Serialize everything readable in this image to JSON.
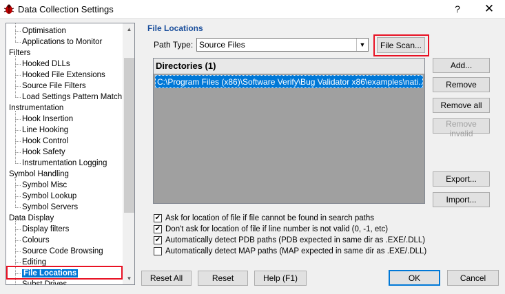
{
  "window": {
    "title": "Data Collection Settings",
    "help": "?",
    "close": "✕"
  },
  "tree": {
    "rows": [
      {
        "label": "Optimisation",
        "level": 1
      },
      {
        "label": "Applications to Monitor",
        "level": 1
      },
      {
        "label": "Filters",
        "level": 0
      },
      {
        "label": "Hooked DLLs",
        "level": 1
      },
      {
        "label": "Hooked File Extensions",
        "level": 1
      },
      {
        "label": "Source File Filters",
        "level": 1
      },
      {
        "label": "Load Settings Pattern Match",
        "level": 1
      },
      {
        "label": "Instrumentation",
        "level": 0
      },
      {
        "label": "Hook Insertion",
        "level": 1
      },
      {
        "label": "Line Hooking",
        "level": 1
      },
      {
        "label": "Hook Control",
        "level": 1
      },
      {
        "label": "Hook Safety",
        "level": 1
      },
      {
        "label": "Instrumentation Logging",
        "level": 1
      },
      {
        "label": "Symbol Handling",
        "level": 0
      },
      {
        "label": "Symbol Misc",
        "level": 1
      },
      {
        "label": "Symbol Lookup",
        "level": 1
      },
      {
        "label": "Symbol Servers",
        "level": 1
      },
      {
        "label": "Data Display",
        "level": 0
      },
      {
        "label": "Display filters",
        "level": 1
      },
      {
        "label": "Colours",
        "level": 1
      },
      {
        "label": "Source Code Browsing",
        "level": 1
      },
      {
        "label": "Editing",
        "level": 1
      },
      {
        "label": "File Locations",
        "level": 1,
        "selected": true
      },
      {
        "label": "Subst Drives",
        "level": 1
      }
    ]
  },
  "content": {
    "section_title": "File Locations",
    "path_type_label": "Path Type:",
    "path_type_value": "Source Files",
    "file_scan": "File Scan...",
    "directories_header": "Directories (1)",
    "directory_path": "C:\\Program Files (x86)\\Software Verify\\Bug Validator x86\\examples\\nati...",
    "buttons": {
      "add": "Add...",
      "remove": "Remove",
      "remove_all": "Remove all",
      "remove_invalid": "Remove invalid",
      "export": "Export...",
      "import": "Import..."
    },
    "checkboxes": [
      {
        "label": "Ask for location of file if file cannot be found in search paths",
        "checked": true
      },
      {
        "label": "Don't ask for location of file if line number is not valid (0, -1, etc)",
        "checked": true
      },
      {
        "label": "Automatically detect PDB paths (PDB expected in same dir as .EXE/.DLL)",
        "checked": true
      },
      {
        "label": "Automatically detect MAP paths (MAP expected in same dir as .EXE/.DLL)",
        "checked": false
      }
    ]
  },
  "footer": {
    "reset_all": "Reset All",
    "reset": "Reset",
    "help": "Help (F1)",
    "ok": "OK",
    "cancel": "Cancel"
  },
  "check_mark": "✔",
  "colors": {
    "accent": "#0078d7",
    "highlight": "#e81123",
    "section_title": "#1b4f9c"
  }
}
